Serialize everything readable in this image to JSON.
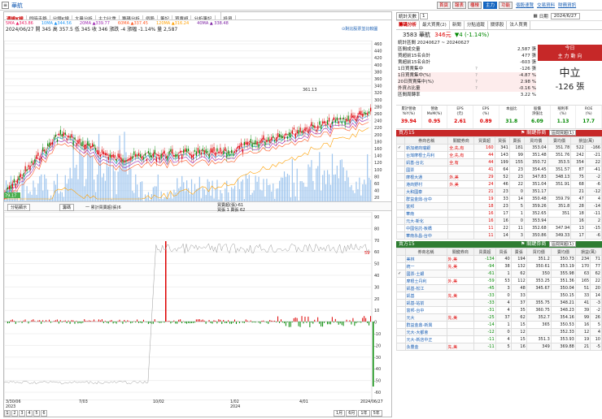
{
  "header": {
    "menu_label": "≡",
    "title": "華航",
    "buttons": [
      "首頁",
      "報表",
      "櫃檯",
      "主力",
      "功能"
    ],
    "links": [
      "個股速覽",
      "交易資料",
      "財務資訊"
    ]
  },
  "chart_tabs": [
    "週線K線",
    "即時走勢",
    "分鐘K線",
    "大量分析",
    "主力比重",
    "籌碼分析",
    "個股",
    "筆記",
    "買賣超",
    "分析筆記",
    "",
    "投資"
  ],
  "ma": [
    {
      "label": "5MA ▲343.86",
      "color": "#e91e63"
    },
    {
      "label": "10MA ▲344.56",
      "color": "#2196f3"
    },
    {
      "label": "20MA ▲339.77",
      "color": "#9c27b0"
    },
    {
      "label": "60MA ▲337.45",
      "color": "#ff5722"
    },
    {
      "label": "120MA ▲316.24",
      "color": "#ffa000"
    },
    {
      "label": "40MA ▲ 338.48",
      "color": "#7b1fa2"
    }
  ],
  "price_info": "2024/06/27  開 345  高 357.5  低 345  收 346  漲跌 -4  漲幅 -1.14%  量 2,587",
  "chart_options_label": "⊙對比股票並比較圖",
  "peak_label": "361.13",
  "low_label": "79.17",
  "y_price": [
    "460",
    "440",
    "420",
    "400",
    "380",
    "360",
    "340",
    "320",
    "300",
    "280",
    "260",
    "240",
    "220",
    "200",
    "180",
    "160",
    "140",
    "120",
    "100",
    "80",
    "60",
    "40",
    "20"
  ],
  "y_osc": [
    "90",
    "80",
    "70",
    "60",
    "50",
    "40",
    "30",
    "20",
    "10",
    "0",
    "-10",
    "-20",
    "-30",
    "-40",
    "-50",
    "-60"
  ],
  "osc_tabs": {
    "left": "分點顯示",
    "mid": "籌碼",
    "legend": "一 累計買賣超(張)6"
  },
  "osc_info": {
    "line1": "買賣超(張)-61",
    "line2": "買張 1 賣張 62"
  },
  "osc_last": "59",
  "x_labels": [
    "3/30/06\n2023",
    "7/03",
    "10/02",
    "1/02\n2024",
    "4/01",
    "2024/06/27"
  ],
  "pager": [
    "1",
    "2",
    "3",
    "4",
    "5",
    "6"
  ],
  "period_btns": [
    "1月",
    "6月",
    "1年",
    "5年"
  ],
  "right": {
    "top_row": {
      "select": "統計天數",
      "val": "1",
      "date_label": "日期",
      "date": "2024/6/27"
    },
    "tabs": [
      "籌碼分析",
      "最大買賣(2)",
      "新聞",
      "分點追蹤",
      "關係股",
      "法人買賣"
    ],
    "stock": "3583 華航",
    "price": "346元",
    "chg": "▼4 (-1.14%)",
    "stats_title": "統計區間 20240627 ~ 20240627",
    "stats": [
      [
        "區間成交量",
        "",
        "2,587 張"
      ],
      [
        "買超前15名合計",
        "",
        "477 張"
      ],
      [
        "賣超前15名合計",
        "",
        "-603 張"
      ],
      [
        "1日買賣集中",
        "?",
        "-126 張"
      ],
      [
        "1日買賣集中(%)",
        "?",
        "-4.87 %"
      ],
      [
        "20日買賣集中(%)",
        "?",
        "2.98 %"
      ],
      [
        "外資占比量",
        "?",
        "-0.16 %"
      ],
      [
        "區間周轉率",
        "",
        "3.22 %"
      ]
    ],
    "today_label": "今日",
    "main_label": "主 力 動 向",
    "trend": "中立",
    "trend_val": "-126 張",
    "fin_heads": [
      "累計營收\nYoY(%)",
      "營收\nMoM(%)",
      "EPS\n(元)",
      "EPS\n(%)",
      "本益比",
      "股價\n淨值比",
      "殖利率\n(%)",
      "ROE\n(%)"
    ],
    "fin_vals": [
      "39.94",
      "0.95",
      "2.61",
      "0.89",
      "31.8",
      "6.09",
      "1.13",
      "17.7"
    ],
    "buy_title": "買方15",
    "sell_title": "賣方15",
    "filter": "⚑ 關鍵券商",
    "select": "區間買超(1)",
    "tbl_heads": [
      "",
      "券商名稱",
      "關鍵券商",
      "買賣超",
      "買張",
      "賣張",
      "買均價",
      "賣均價",
      "損益(萬)"
    ],
    "buy_rows": [
      [
        "✓",
        "新加坡商瑞銀",
        "全,先,有",
        "160",
        "341",
        "181",
        "353.04",
        "351.78",
        "522",
        "-166"
      ],
      [
        "",
        "台灣摩根士丹利",
        "全,先,有",
        "44",
        "143",
        "99",
        "351.48",
        "351.76",
        "242",
        "-21"
      ],
      [
        "",
        "凱基-台北",
        "全,有",
        "44",
        "199",
        "155",
        "350.72",
        "353.5",
        "354",
        "22"
      ],
      [
        "",
        "國票",
        "",
        "41",
        "64",
        "23",
        "354.45",
        "351.57",
        "87",
        "-41"
      ],
      [
        "",
        "摩根大通",
        "外,美",
        "29",
        "52",
        "23",
        "347.83",
        "348.13",
        "75",
        "-2"
      ],
      [
        "",
        "港商野村",
        "外,美",
        "24",
        "46",
        "22",
        "351.04",
        "351.91",
        "68",
        "-6"
      ],
      [
        "",
        "大和國泰",
        "",
        "21",
        "23",
        "0",
        "351.17",
        "",
        "21",
        "-12"
      ],
      [
        "",
        "群益金鼎-台中",
        "",
        "19",
        "33",
        "14",
        "350.48",
        "359.79",
        "47",
        "4"
      ],
      [
        "",
        "富邦",
        "",
        "18",
        "23",
        "5",
        "359.26",
        "351.8",
        "28",
        "-14"
      ],
      [
        "",
        "華南",
        "",
        "16",
        "17",
        "1",
        "352.65",
        "351",
        "18",
        "-11"
      ],
      [
        "",
        "元大-新化",
        "",
        "16",
        "16",
        "0",
        "353.94",
        "",
        "16",
        "2"
      ],
      [
        "",
        "中國信託-板橋",
        "",
        "11",
        "22",
        "11",
        "352.68",
        "347.94",
        "13",
        "-15"
      ],
      [
        "",
        "華南永昌-台中",
        "",
        "11",
        "14",
        "3",
        "350.86",
        "349.33",
        "17",
        "-6"
      ]
    ],
    "sell_rows": [
      [
        "",
        "美林",
        "外,美",
        "-134",
        "40",
        "194",
        "351.2",
        "350.73",
        "234",
        "71"
      ],
      [
        "",
        "統一",
        "先,美",
        "-94",
        "38",
        "132",
        "350.61",
        "353.19",
        "170",
        "77"
      ],
      [
        "✓",
        "國票-土銀",
        "",
        "-61",
        "1",
        "62",
        "350",
        "355.98",
        "63",
        "62"
      ],
      [
        "",
        "摩根士丹利",
        "外,美",
        "-59",
        "53",
        "112",
        "353.25",
        "351.36",
        "165",
        "22"
      ],
      [
        "",
        "凱基-松江",
        "",
        "-45",
        "3",
        "48",
        "345.67",
        "350.04",
        "51",
        "20"
      ],
      [
        "",
        "凱基",
        "先,美",
        "-33",
        "0",
        "33",
        "",
        "350.15",
        "33",
        "14"
      ],
      [
        "",
        "凱基-站前",
        "",
        "-33",
        "4",
        "37",
        "355.75",
        "348.21",
        "41",
        "-3"
      ],
      [
        "",
        "富邦-台中",
        "",
        "-31",
        "4",
        "35",
        "360.75",
        "348.23",
        "39",
        "-2"
      ],
      [
        "",
        "元大",
        "先,美",
        "-25",
        "37",
        "62",
        "352.7",
        "354.16",
        "99",
        "26"
      ],
      [
        "",
        "群益金鼎-新興",
        "",
        "-14",
        "1",
        "15",
        "365",
        "350.53",
        "16",
        "5"
      ],
      [
        "",
        "元大-大都會",
        "",
        "-12",
        "0",
        "12",
        "",
        "352.33",
        "12",
        "4"
      ],
      [
        "",
        "元大-新店中正",
        "",
        "-11",
        "4",
        "15",
        "351.3",
        "353.93",
        "19",
        "10"
      ],
      [
        "",
        "永豐金",
        "先,美",
        "-11",
        "5",
        "16",
        "349",
        "369.88",
        "21",
        "-5"
      ]
    ]
  }
}
